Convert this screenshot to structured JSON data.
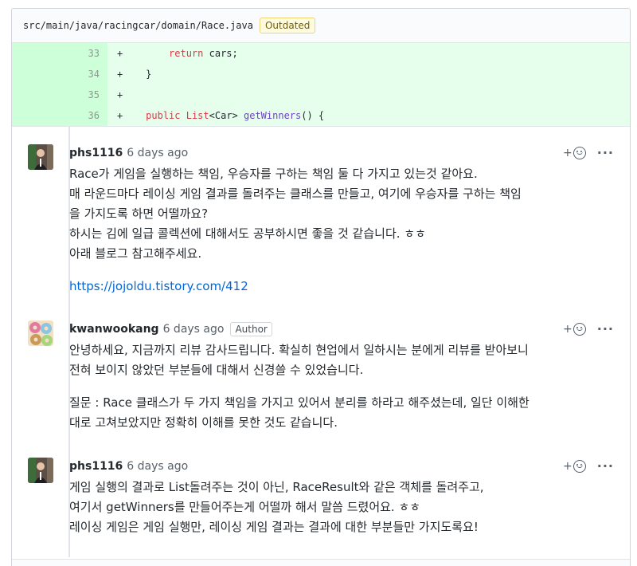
{
  "file": {
    "path": "src/main/java/racingcar/domain/Race.java",
    "badge": "Outdated"
  },
  "diff_lines": [
    {
      "num": "33",
      "sign": "+",
      "code": "        return cars;"
    },
    {
      "num": "34",
      "sign": "+",
      "code": "    }"
    },
    {
      "num": "35",
      "sign": "+",
      "code": ""
    },
    {
      "num": "36",
      "sign": "+",
      "code": "    public List<Car> getWinners() {"
    }
  ],
  "comments": [
    {
      "author": "phs1116",
      "time": "6 days ago",
      "lines": [
        "Race가 게임을 실행하는 책임, 우승자를 구하는 책임 둘 다 가지고 있는것 같아요.",
        "매 라운드마다 레이싱 게임 결과를 돌려주는 클래스를 만들고, 여기에 우승자를 구하는 책임",
        "을 가지도록 하면 어떨까요?",
        "하시는 김에 일급 콜렉션에 대해서도 공부하시면 좋을 것 같습니다. ㅎㅎ",
        "아래 블로그 참고해주세요."
      ],
      "link": "https://jojoldu.tistory.com/412"
    },
    {
      "author": "kwanwookang",
      "time": "6 days ago",
      "badge": "Author",
      "para1": [
        "안녕하세요, 지금까지 리뷰 감사드립니다. 확실히 현업에서 일하시는 분에게 리뷰를 받아보니",
        "전혀 보이지 않았던 부분들에 대해서 신경쓸 수 있었습니다."
      ],
      "para2": [
        "질문 : Race 클래스가 두 가지 책임을 가지고 있어서 분리를 하라고 해주셨는데, 일단 이해한",
        "대로 고쳐보았지만 정확히 이해를 못한 것도 같습니다."
      ]
    },
    {
      "author": "phs1116",
      "time": "6 days ago",
      "lines": [
        "게임 실행의 결과로 List돌려주는 것이 아닌, RaceResult와 같은 객체를 돌려주고,",
        "여기서 getWinners를 만들어주는게 어떨까 해서 말씀 드렸어요. ㅎㅎ",
        "레이싱 게임은 게임 실행만, 레이싱 게임 결과는 결과에 대한 부분들만 가지도록요!"
      ]
    }
  ],
  "actions": {
    "react": "+",
    "more": "···"
  },
  "colors": {
    "added_bg": "#e6ffed",
    "added_gutter": "#cdffd8",
    "link": "#0366d6"
  }
}
